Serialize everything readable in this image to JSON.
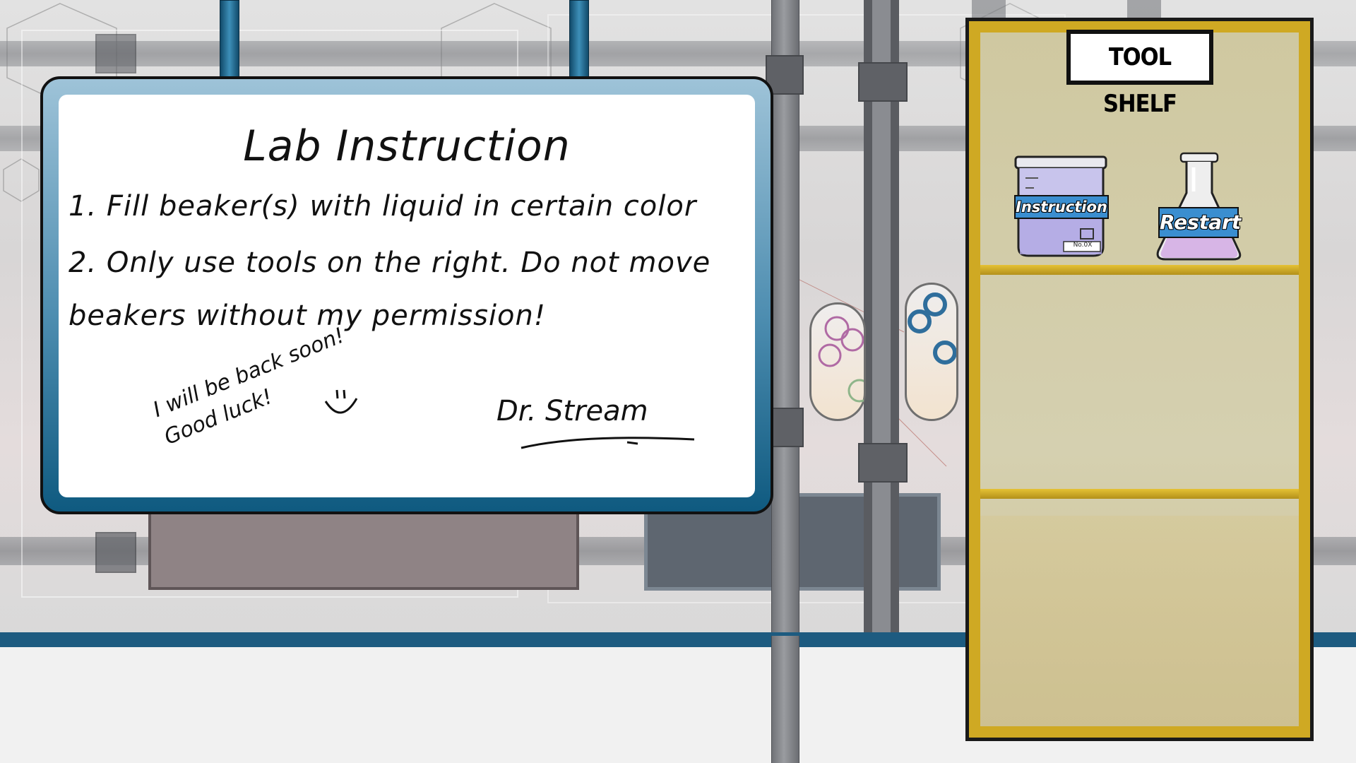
{
  "sign": {
    "title": "Lab Instruction",
    "lines": [
      "1. Fill beaker(s) with liquid in certain color",
      "2. Only use tools on the right. Do not move",
      "beakers without my permission!"
    ],
    "note_lines": [
      "I will be back soon!",
      "Good luck!"
    ],
    "smiley": ":)",
    "signature": "Dr. Stream"
  },
  "shelf": {
    "title": "TOOL SHELF",
    "tools": [
      {
        "label": "Instruction",
        "sublabel": "No.0X",
        "icon": "beaker-jar-icon"
      },
      {
        "label": "Restart",
        "icon": "flask-icon"
      }
    ]
  },
  "beakers": [
    {
      "ring_color": "#b06aa4",
      "extra_ring_color": "#8fb58a"
    },
    {
      "ring_color": "#2f6e9c"
    }
  ],
  "colors": {
    "shelf_frame": "#cfa923",
    "sign_frame": "#0f5a80",
    "floor_stripe": "#1d5b80",
    "tool_tag": "#3a8ed0"
  }
}
